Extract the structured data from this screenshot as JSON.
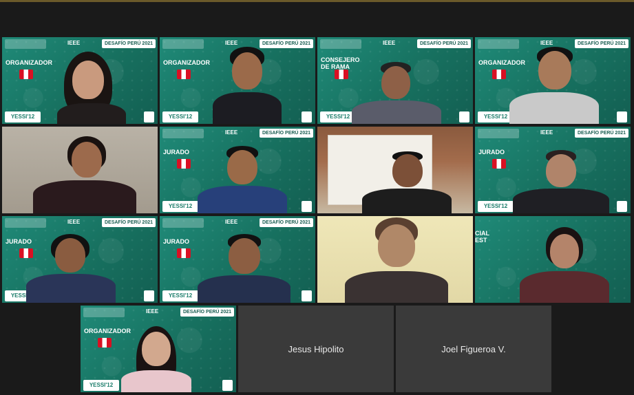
{
  "meeting": {
    "badge_text": "DESAFÍO PERÚ 2021",
    "ieee_text": "IEEE",
    "event_logo_text": "YESSI'12"
  },
  "tiles": [
    {
      "id": "t1",
      "role": "ORGANIZADOR"
    },
    {
      "id": "t2",
      "role": "ORGANIZADOR"
    },
    {
      "id": "t3",
      "role": "CONSEJERO\nDE RAMA"
    },
    {
      "id": "t4",
      "role": "ORGANIZADOR"
    },
    {
      "id": "t5",
      "role": ""
    },
    {
      "id": "t6",
      "role": "JURADO"
    },
    {
      "id": "t7",
      "role": ""
    },
    {
      "id": "t8",
      "role": "JURADO"
    },
    {
      "id": "t9",
      "role": "JURADO"
    },
    {
      "id": "t10",
      "role": "JURADO"
    },
    {
      "id": "t11",
      "role": ""
    },
    {
      "id": "t12",
      "role": "CIAL\nEST"
    },
    {
      "id": "t13",
      "role": "ORGANIZADOR"
    }
  ],
  "name_tiles": [
    {
      "name": "Jesus Hipolito"
    },
    {
      "name": "Joel Figueroa V."
    }
  ]
}
